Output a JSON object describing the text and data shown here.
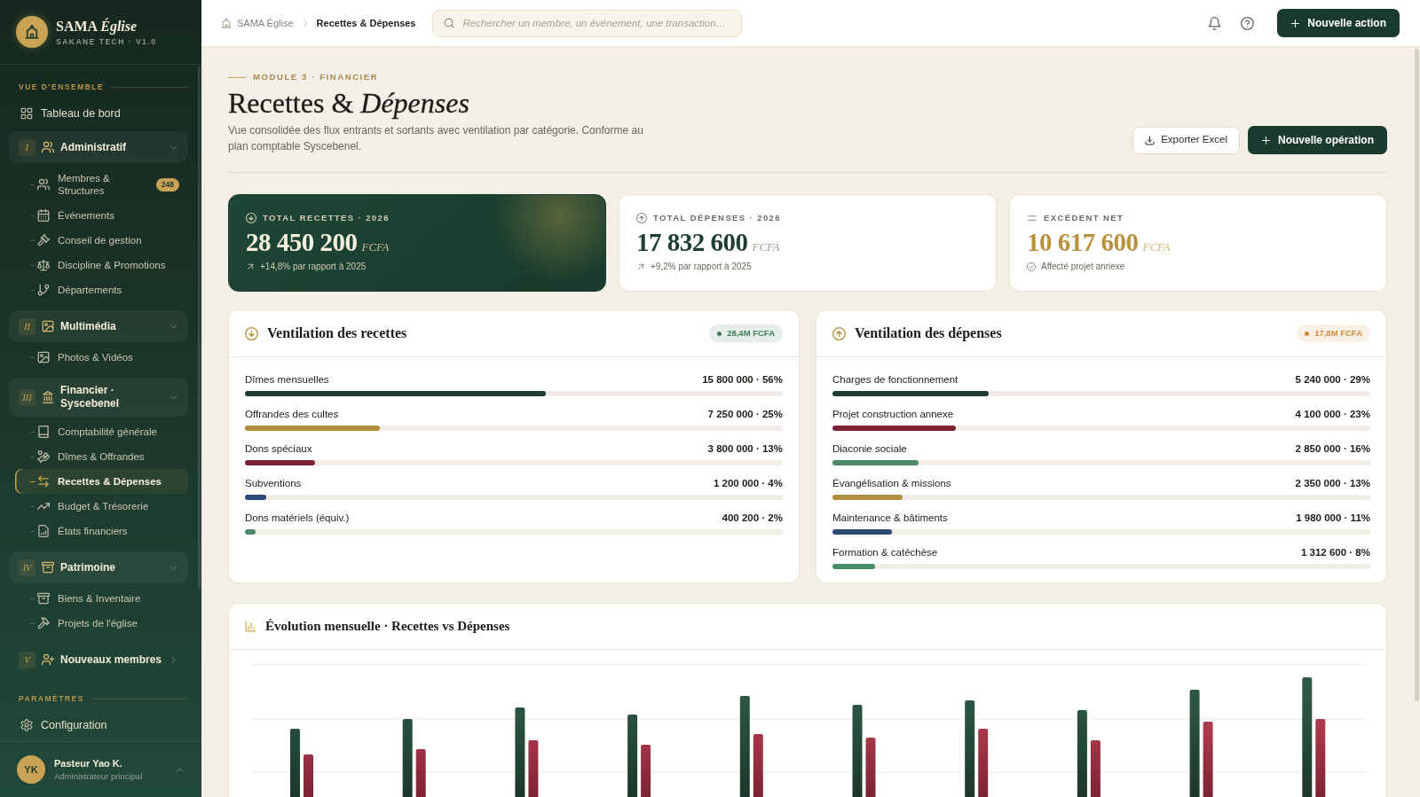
{
  "brand": {
    "name": "SAMA *Église*",
    "tagline": "SAKANE TECH · V1.0"
  },
  "sidebar": {
    "sections": [
      {
        "title": "VUE D'ENSEMBLE",
        "items": [
          {
            "kind": "link",
            "label": "Tableau de bord",
            "selected": false
          },
          {
            "kind": "group",
            "numeral": "I",
            "label": "Administratif",
            "expanded": true,
            "children": [
              {
                "label": "Membres & Structures",
                "badge": "248",
                "selected": false
              },
              {
                "label": "Événements",
                "selected": false
              },
              {
                "label": "Conseil de gestion",
                "selected": false
              },
              {
                "label": "Discipline & Promotions",
                "selected": false
              },
              {
                "label": "Départements",
                "selected": false
              }
            ]
          },
          {
            "kind": "group",
            "numeral": "II",
            "label": "Multimédia",
            "expanded": true,
            "children": [
              {
                "label": "Photos & Vidéos",
                "selected": false
              }
            ]
          },
          {
            "kind": "group",
            "numeral": "III",
            "label": "Financier · Syscebenel",
            "expanded": true,
            "children": [
              {
                "label": "Comptabilité générale",
                "selected": false
              },
              {
                "label": "Dîmes & Offrandes",
                "selected": false
              },
              {
                "label": "Recettes & Dépenses",
                "selected": true
              },
              {
                "label": "Budget & Trésorerie",
                "selected": false
              },
              {
                "label": "États financiers",
                "selected": false
              }
            ]
          },
          {
            "kind": "group",
            "numeral": "IV",
            "label": "Patrimoine",
            "expanded": true,
            "children": [
              {
                "label": "Biens & Inventaire",
                "selected": false
              },
              {
                "label": "Projets de l'église",
                "selected": false
              }
            ]
          },
          {
            "kind": "group",
            "numeral": "V",
            "label": "Nouveaux membres",
            "expanded": false
          }
        ]
      },
      {
        "title": "PARAMÈTRES",
        "items": [
          {
            "kind": "link",
            "label": "Configuration",
            "selected": false
          }
        ]
      }
    ]
  },
  "user": {
    "initials": "YK",
    "name": "Pasteur Yao K.",
    "role": "Administrateur principal"
  },
  "topbar": {
    "breadcrumb": [
      "SAMA Église",
      "Recettes & Dépenses"
    ],
    "search": {
      "placeholder": "Rechercher un membre, un événement, une transaction…"
    },
    "action_button": "Nouvelle action"
  },
  "page": {
    "eyebrow": "MODULE 3 · FINANCIER",
    "title": "Recettes & *Dépenses*",
    "description": "Vue consolidée des flux entrants et sortants avec ventilation par catégorie. Conforme au plan comptable Syscebenel.",
    "buttons": [
      {
        "kind": "export",
        "label": "Exporter Excel"
      },
      {
        "kind": "create",
        "label": "Nouvelle opération"
      }
    ]
  },
  "kpis": [
    {
      "kind": "income",
      "label": "TOTAL RECETTES · 2026",
      "value": "28 450 200",
      "unit": "FCFA",
      "note": "+14,8% par rapport à 2025"
    },
    {
      "kind": "expense",
      "label": "TOTAL DÉPENSES · 2026",
      "value": "17 832 600",
      "unit": "FCFA",
      "note": "+9,2% par rapport à 2025"
    },
    {
      "kind": "net",
      "label": "EXCÉDENT NET",
      "value": "10 617 600",
      "unit": "FCFA",
      "note": "Affecté projet annexe"
    }
  ],
  "breakdowns": [
    {
      "kind": "income",
      "title": "Ventilation des recettes",
      "badge": {
        "text": "28,4M FCFA",
        "color": "#3d7a56"
      },
      "rows": [
        {
          "label": "Dîmes mensuelles",
          "amount": "15 800 000 · 56%",
          "level": 0.56,
          "color": "#1f3d32"
        },
        {
          "label": "Offrandes des cultes",
          "amount": "7 250 000 · 25%",
          "level": 0.25,
          "color": "#b08d3e"
        },
        {
          "label": "Dons spéciaux",
          "amount": "3 800 000 · 13%",
          "level": 0.13,
          "color": "#7a2336"
        },
        {
          "label": "Subventions",
          "amount": "1 200 000 · 4%",
          "level": 0.04,
          "color": "#2d4a78"
        },
        {
          "label": "Dons matériels (équiv.)",
          "amount": "400 200 · 2%",
          "level": 0.02,
          "color": "#4a8a68"
        }
      ]
    },
    {
      "kind": "expense",
      "title": "Ventilation des dépenses",
      "badge": {
        "text": "17,8M FCFA",
        "color": "#d08a3c"
      },
      "rows": [
        {
          "label": "Charges de fonctionnement",
          "amount": "5 240 000 · 29%",
          "level": 0.29,
          "color": "#1f3d32"
        },
        {
          "label": "Projet construction annexe",
          "amount": "4 100 000 · 23%",
          "level": 0.23,
          "color": "#7a2336"
        },
        {
          "label": "Diaconie sociale",
          "amount": "2 850 000 · 16%",
          "level": 0.16,
          "color": "#4a8a68"
        },
        {
          "label": "Évangélisation & missions",
          "amount": "2 350 000 · 13%",
          "level": 0.13,
          "color": "#b08d3e"
        },
        {
          "label": "Maintenance & bâtiments",
          "amount": "1 980 000 · 11%",
          "level": 0.11,
          "color": "#2d4a78"
        },
        {
          "label": "Formation & catéchèse",
          "amount": "1 312 600 · 8%",
          "level": 0.08,
          "color": "#4a8a68"
        }
      ]
    }
  ],
  "chart_panel": {
    "title": "Évolution mensuelle · Recettes vs Dépenses"
  }
}
